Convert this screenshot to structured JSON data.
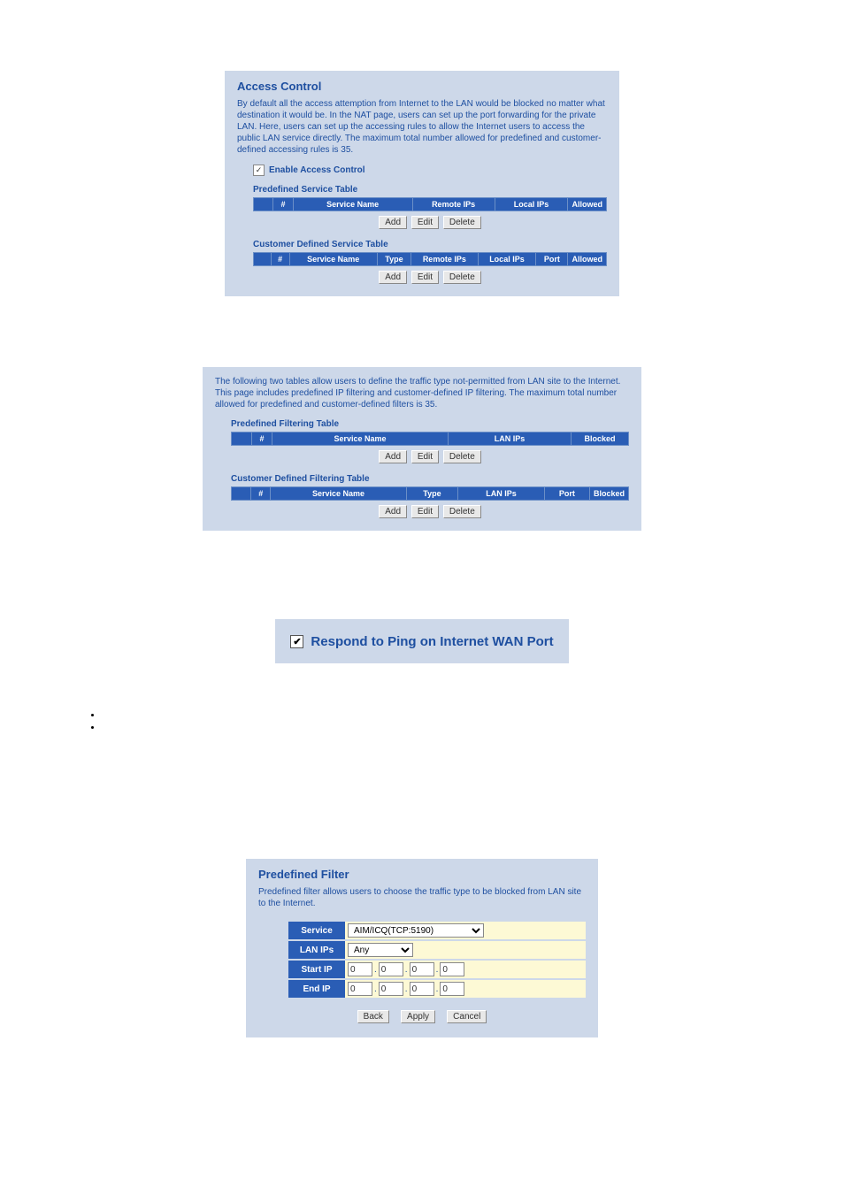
{
  "access": {
    "title": "Access Control",
    "desc": "By default all the access attemption from Internet to the LAN would be blocked no matter what destination it would be. In the NAT page, users can set up the port forwarding for the private LAN. Here, users can set up the accessing rules to allow the Internet users to access the public LAN service directly. The maximum total number allowed for predefined and customer-defined accessing rules is 35.",
    "enable_label": "Enable Access Control",
    "predef": {
      "label": "Predefined Service Table",
      "cols": {
        "num": "#",
        "service": "Service Name",
        "remote": "Remote IPs",
        "local": "Local IPs",
        "allowed": "Allowed"
      }
    },
    "custdef": {
      "label": "Customer Defined Service Table",
      "cols": {
        "num": "#",
        "service": "Service Name",
        "type": "Type",
        "remote": "Remote IPs",
        "local": "Local IPs",
        "port": "Port",
        "allowed": "Allowed"
      }
    },
    "btns": {
      "add": "Add",
      "edit": "Edit",
      "del": "Delete"
    }
  },
  "filter": {
    "desc": "The following two tables allow users to define the traffic type not-permitted from LAN site to the Internet. This page includes predefined IP filtering and customer-defined IP filtering. The maximum total number allowed for predefined and customer-defined filters is 35.",
    "predef": {
      "label": "Predefined Filtering Table",
      "cols": {
        "num": "#",
        "service": "Service Name",
        "lanips": "LAN IPs",
        "blocked": "Blocked"
      }
    },
    "custdef": {
      "label": "Customer Defined Filtering Table",
      "cols": {
        "num": "#",
        "service": "Service Name",
        "type": "Type",
        "lanips": "LAN IPs",
        "port": "Port",
        "blocked": "Blocked"
      }
    },
    "btns": {
      "add": "Add",
      "edit": "Edit",
      "del": "Delete"
    }
  },
  "ping": {
    "label": "Respond to Ping on Internet WAN Port"
  },
  "predef_filter": {
    "title": "Predefined Filter",
    "desc": "Predefined filter allows users to choose the traffic type to be blocked from LAN site to the Internet.",
    "labels": {
      "service": "Service",
      "lanips": "LAN IPs",
      "startip": "Start IP",
      "endip": "End IP"
    },
    "service_value": "AIM/ICQ(TCP:5190)",
    "lanips_value": "Any",
    "start_ip": [
      "0",
      "0",
      "0",
      "0"
    ],
    "end_ip": [
      "0",
      "0",
      "0",
      "0"
    ],
    "btns": {
      "back": "Back",
      "apply": "Apply",
      "cancel": "Cancel"
    }
  }
}
